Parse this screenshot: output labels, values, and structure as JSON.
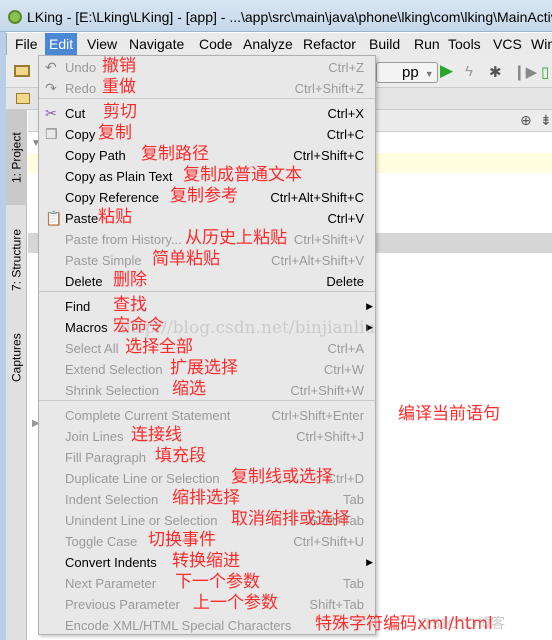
{
  "window": {
    "title": "LKing - [E:\\Lking\\LKing] - [app] - ...\\app\\src\\main\\java\\phone\\lking\\com\\lking\\MainActivity"
  },
  "menubar": [
    "File",
    "Edit",
    "View",
    "Navigate",
    "Code",
    "Analyze",
    "Refactor",
    "Build",
    "Run",
    "Tools",
    "VCS",
    "Win"
  ],
  "toolbar": {
    "run_config": "pp"
  },
  "side_tabs": {
    "project": "1: Project",
    "structure": "7: Structure",
    "captures": "Captures"
  },
  "edit_menu": {
    "items": [
      {
        "label": "Undo",
        "annotation": "撤销",
        "shortcut": "Ctrl+Z",
        "enabled": false,
        "icon": "undo-icon"
      },
      {
        "label": "Redo",
        "annotation": "重做",
        "shortcut": "Ctrl+Shift+Z",
        "enabled": false,
        "icon": "redo-icon"
      },
      {
        "label": "Cut",
        "annotation": "剪切",
        "shortcut": "Ctrl+X",
        "enabled": true,
        "icon": "scissors-icon"
      },
      {
        "label": "Copy",
        "annotation": "复制",
        "shortcut": "Ctrl+C",
        "enabled": true,
        "icon": "copy-icon"
      },
      {
        "label": "Copy Path",
        "annotation": "复制路径",
        "shortcut": "Ctrl+Shift+C",
        "enabled": true
      },
      {
        "label": "Copy as Plain Text",
        "annotation": "复制成普通文本",
        "shortcut": "",
        "enabled": true
      },
      {
        "label": "Copy Reference",
        "annotation": "复制参考",
        "shortcut": "Ctrl+Alt+Shift+C",
        "enabled": true
      },
      {
        "label": "Paste",
        "annotation": "粘贴",
        "shortcut": "Ctrl+V",
        "enabled": true,
        "icon": "paste-icon"
      },
      {
        "label": "Paste from History...",
        "annotation": "从历史上粘贴",
        "shortcut": "Ctrl+Shift+V",
        "enabled": false
      },
      {
        "label": "Paste Simple",
        "annotation": "简单粘贴",
        "shortcut": "Ctrl+Alt+Shift+V",
        "enabled": false
      },
      {
        "label": "Delete",
        "annotation": "删除",
        "shortcut": "Delete",
        "enabled": true
      },
      {
        "label": "Find",
        "annotation": "查找",
        "shortcut": "",
        "enabled": true,
        "submenu": true
      },
      {
        "label": "Macros",
        "annotation": "宏命令",
        "shortcut": "",
        "enabled": true,
        "submenu": true
      },
      {
        "label": "Select All",
        "annotation": "选择全部",
        "shortcut": "Ctrl+A",
        "enabled": false
      },
      {
        "label": "Extend Selection",
        "annotation": "扩展选择",
        "shortcut": "Ctrl+W",
        "enabled": false
      },
      {
        "label": "Shrink Selection",
        "annotation": "缩选",
        "shortcut": "Ctrl+Shift+W",
        "enabled": false
      },
      {
        "label": "Complete Current Statement",
        "annotation": "编译当前语句",
        "shortcut": "Ctrl+Shift+Enter",
        "enabled": false
      },
      {
        "label": "Join Lines",
        "annotation": "连接线",
        "shortcut": "Ctrl+Shift+J",
        "enabled": false
      },
      {
        "label": "Fill Paragraph",
        "annotation": "填充段",
        "shortcut": "",
        "enabled": false
      },
      {
        "label": "Duplicate Line or Selection",
        "annotation": "复制线或选择",
        "shortcut": "Ctrl+D",
        "enabled": false
      },
      {
        "label": "Indent Selection",
        "annotation": "缩排选择",
        "shortcut": "Tab",
        "enabled": false
      },
      {
        "label": "Unindent Line or Selection",
        "annotation": "取消缩排或选择",
        "shortcut": "Shift+Tab",
        "enabled": false
      },
      {
        "label": "Toggle Case",
        "annotation": "切换事件",
        "shortcut": "Ctrl+Shift+U",
        "enabled": false
      },
      {
        "label": "Convert Indents",
        "annotation": "转换缩进",
        "shortcut": "",
        "enabled": true,
        "submenu": true
      },
      {
        "label": "Next Parameter",
        "annotation": "下一个参数",
        "shortcut": "Tab",
        "enabled": false
      },
      {
        "label": "Previous Parameter",
        "annotation": "上一个参数",
        "shortcut": "Shift+Tab",
        "enabled": false
      },
      {
        "label": "Encode XML/HTML Special Characters",
        "annotation": "特殊字符编码xml/html",
        "shortcut": "",
        "enabled": false
      }
    ]
  },
  "watermarks": {
    "blog": "http://blog.csdn.net/binjianliu",
    "site": "@51CTO博客"
  },
  "colors": {
    "annotation": "#ff2b2b",
    "menu_highlight": "#4a88d6",
    "menu_bg": "#e8e8e8"
  }
}
